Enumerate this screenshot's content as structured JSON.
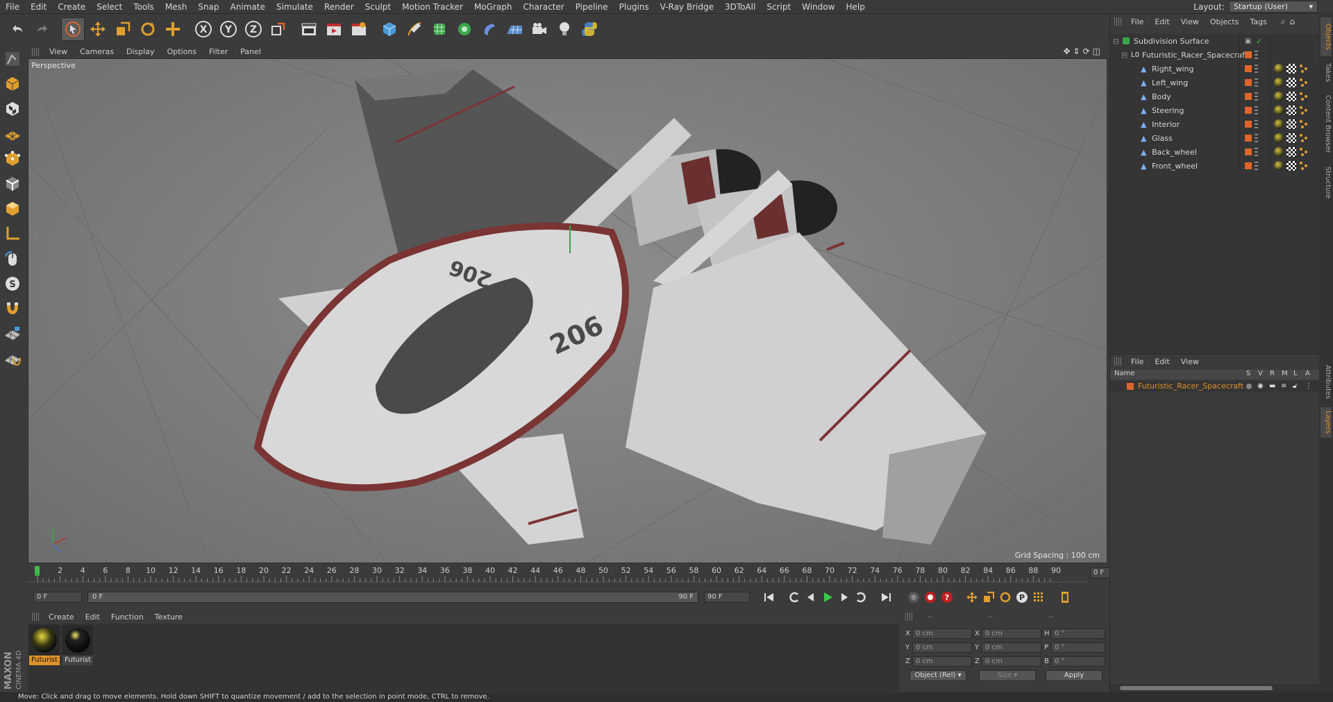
{
  "menubar": {
    "items": [
      "File",
      "Edit",
      "Create",
      "Select",
      "Tools",
      "Mesh",
      "Snap",
      "Animate",
      "Simulate",
      "Render",
      "Sculpt",
      "Motion Tracker",
      "MoGraph",
      "Character",
      "Pipeline",
      "Plugins",
      "V-Ray Bridge",
      "3DToAll",
      "Script",
      "Window",
      "Help"
    ],
    "layout_label": "Layout:",
    "layout_value": "Startup (User)"
  },
  "viewport": {
    "menu": [
      "View",
      "Cameras",
      "Display",
      "Options",
      "Filter",
      "Panel"
    ],
    "label": "Perspective",
    "grid_spacing": "Grid Spacing : 100 cm",
    "ship_number_top": "206",
    "ship_number_side": "206"
  },
  "timeline": {
    "ticks": [
      "0",
      "2",
      "4",
      "6",
      "8",
      "10",
      "12",
      "14",
      "16",
      "18",
      "20",
      "22",
      "24",
      "26",
      "28",
      "30",
      "32",
      "34",
      "36",
      "38",
      "40",
      "42",
      "44",
      "46",
      "48",
      "50",
      "52",
      "54",
      "56",
      "58",
      "60",
      "62",
      "64",
      "66",
      "68",
      "70",
      "72",
      "74",
      "76",
      "78",
      "80",
      "82",
      "84",
      "86",
      "88",
      "90"
    ],
    "current_frame_right": "0 F",
    "start_field": "0 F",
    "slider_left": "0 F",
    "slider_right": "90 F",
    "end_field": "90 F"
  },
  "materials": {
    "menu": [
      "Create",
      "Edit",
      "Function",
      "Texture"
    ],
    "items": [
      {
        "label": "Futurist",
        "selected": true
      },
      {
        "label": "Futurist",
        "selected": false
      }
    ]
  },
  "coords": {
    "header": [
      "--",
      "--",
      "--"
    ],
    "rows": [
      {
        "a": "X",
        "v1": "0 cm",
        "b": "X",
        "v2": "0 cm",
        "c": "H",
        "v3": "0 °"
      },
      {
        "a": "Y",
        "v1": "0 cm",
        "b": "Y",
        "v2": "0 cm",
        "c": "P",
        "v3": "0 °"
      },
      {
        "a": "Z",
        "v1": "0 cm",
        "b": "Z",
        "v2": "0 cm",
        "c": "B",
        "v3": "0 °"
      }
    ],
    "mode_select": "Object (Rel)",
    "size_select": "Size",
    "apply_label": "Apply"
  },
  "object_manager": {
    "menu": [
      "File",
      "Edit",
      "View",
      "Objects",
      "Tags"
    ],
    "objects": [
      {
        "name": "Subdivision Surface",
        "level": 0
      },
      {
        "name": "Futuristic_Racer_Spacecraft",
        "level": 1
      },
      {
        "name": "Right_wing",
        "level": 2
      },
      {
        "name": "Left_wing",
        "level": 2
      },
      {
        "name": "Body",
        "level": 2
      },
      {
        "name": "Steering",
        "level": 2
      },
      {
        "name": "Interior",
        "level": 2
      },
      {
        "name": "Glass",
        "level": 2
      },
      {
        "name": "Back_wheel",
        "level": 2
      },
      {
        "name": "Front_wheel",
        "level": 2
      }
    ]
  },
  "layer_manager": {
    "menu": [
      "File",
      "Edit",
      "View"
    ],
    "columns": [
      "Name",
      "S",
      "V",
      "R",
      "M",
      "L",
      "A"
    ],
    "layer_name": "Futuristic_Racer_Spacecraft"
  },
  "side_tabs": [
    "Objects",
    "Takes",
    "Content Browser",
    "Structure",
    "Attributes",
    "Layers"
  ],
  "status": "Move: Click and drag to move elements. Hold down SHIFT to quantize movement / add to the selection in point mode, CTRL to remove.",
  "colors": {
    "accent_orange": "#e0922a",
    "layer_orange": "#e0652a",
    "viewport_bg": "#808080",
    "ship_trim": "#7a3434"
  }
}
